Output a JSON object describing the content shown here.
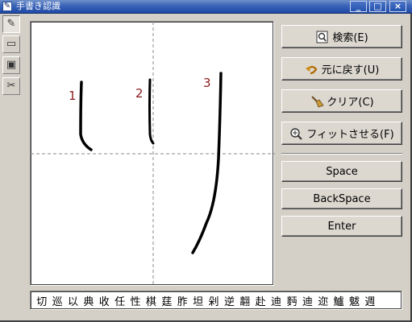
{
  "window": {
    "title": "手書き認識",
    "controls": {
      "minimize": "_",
      "maximize": "□",
      "close": "×"
    }
  },
  "toolbar": {
    "tools": [
      {
        "name": "pen-icon",
        "glyph": "✎"
      },
      {
        "name": "speech-bubble-icon",
        "glyph": "▭"
      },
      {
        "name": "dictionary-icon",
        "glyph": "▣"
      },
      {
        "name": "scissors-icon",
        "glyph": "✂"
      }
    ]
  },
  "canvas": {
    "stroke_labels": [
      "1",
      "2",
      "3"
    ]
  },
  "buttons": {
    "search": "検索(E)",
    "undo": "元に戻す(U)",
    "clear": "クリア(C)",
    "fit": "フィットさせる(F)",
    "space": "Space",
    "backspace": "BackSpace",
    "enter": "Enter"
  },
  "candidates": [
    "切",
    "巡",
    "以",
    "典",
    "收",
    "任",
    "性",
    "棋",
    "莛",
    "胙",
    "坦",
    "剁",
    "逆",
    "翿",
    "赴",
    "迪",
    "麪",
    "迪",
    "迩",
    "鱸",
    "魃",
    "週"
  ],
  "colors": {
    "titlebar": "#2452b0",
    "stroke_label": "#8b1a1a",
    "window_bg": "#d4d0c8"
  }
}
